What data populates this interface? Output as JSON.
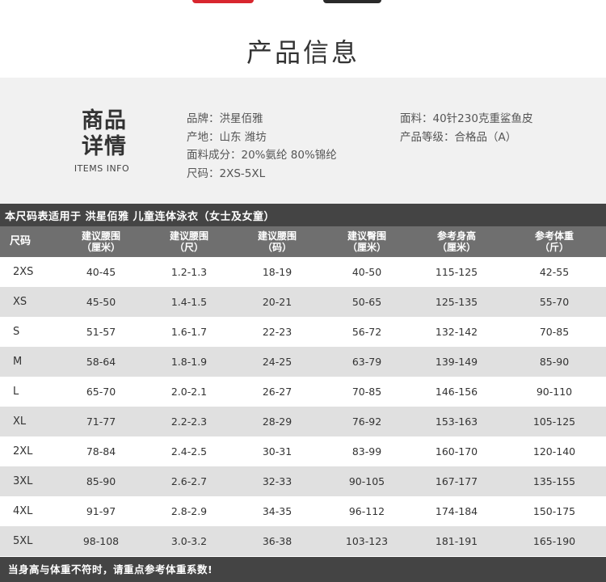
{
  "colors": {
    "accent_red": "#d8262e",
    "dark_header": "#444444",
    "mid_header": "#6f6f6f",
    "stripe": "#e0e0e0",
    "info_bg": "#f1f1f1"
  },
  "page_title": "产品信息",
  "info": {
    "heading_line1": "商品",
    "heading_line2": "详情",
    "heading_en": "ITEMS INFO",
    "left": [
      "品牌：洪星佰雅",
      "产地：山东 潍坊",
      "面料成分：20%氨纶  80%锦纶",
      "尺码：2XS-5XL"
    ],
    "right": [
      "面料：40针230克重鲨鱼皮",
      "产品等级：合格品（A）"
    ]
  },
  "table": {
    "caption": "本尺码表适用于 洪星佰雅 儿童连体泳衣（女士及女童）",
    "headers": [
      {
        "line1": "尺码",
        "line2": ""
      },
      {
        "line1": "建议腰围",
        "line2": "（厘米）"
      },
      {
        "line1": "建议腰围",
        "line2": "（尺）"
      },
      {
        "line1": "建议腰围",
        "line2": "（码）"
      },
      {
        "line1": "建议臀围",
        "line2": "（厘米）"
      },
      {
        "line1": "参考身高",
        "line2": "（厘米）"
      },
      {
        "line1": "参考体重",
        "line2": "（斤）"
      }
    ],
    "rows": [
      [
        "2XS",
        "40-45",
        "1.2-1.3",
        "18-19",
        "40-50",
        "115-125",
        "42-55"
      ],
      [
        "XS",
        "45-50",
        "1.4-1.5",
        "20-21",
        "50-65",
        "125-135",
        "55-70"
      ],
      [
        "S",
        "51-57",
        "1.6-1.7",
        "22-23",
        "56-72",
        "132-142",
        "70-85"
      ],
      [
        "M",
        "58-64",
        "1.8-1.9",
        "24-25",
        "63-79",
        "139-149",
        "85-90"
      ],
      [
        "L",
        "65-70",
        "2.0-2.1",
        "26-27",
        "70-85",
        "146-156",
        "90-110"
      ],
      [
        "XL",
        "71-77",
        "2.2-2.3",
        "28-29",
        "76-92",
        "153-163",
        "105-125"
      ],
      [
        "2XL",
        "78-84",
        "2.4-2.5",
        "30-31",
        "83-99",
        "160-170",
        "120-140"
      ],
      [
        "3XL",
        "85-90",
        "2.6-2.7",
        "32-33",
        "90-105",
        "167-177",
        "135-155"
      ],
      [
        "4XL",
        "91-97",
        "2.8-2.9",
        "34-35",
        "96-112",
        "174-184",
        "150-175"
      ],
      [
        "5XL",
        "98-108",
        "3.0-3.2",
        "36-38",
        "103-123",
        "181-191",
        "165-190"
      ]
    ]
  },
  "footer_note": "当身高与体重不符时，请重点参考体重系数!"
}
